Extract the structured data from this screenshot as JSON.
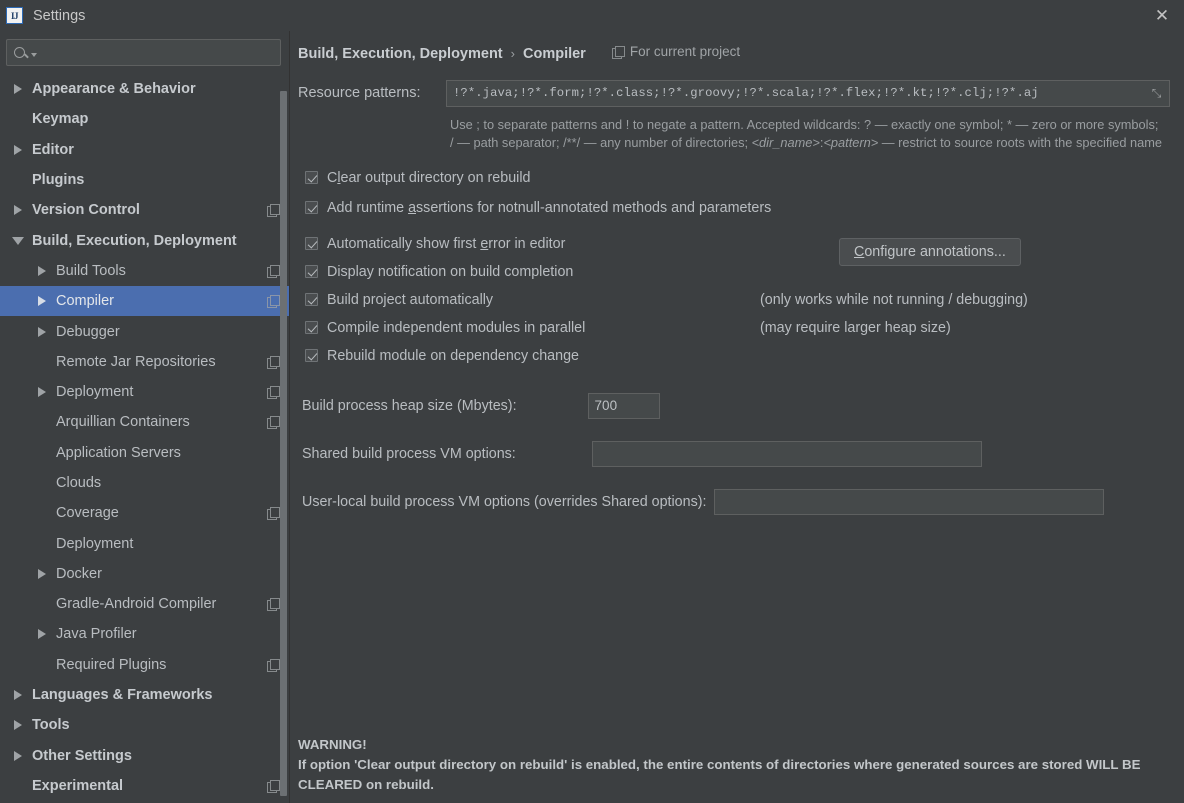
{
  "window": {
    "title": "Settings",
    "logo_text": "IJ",
    "close_label": "✕"
  },
  "sidebar": {
    "search_placeholder": "",
    "search_value": "",
    "items": [
      {
        "label": "Appearance & Behavior",
        "indent": 0,
        "arrow": "right",
        "bold": true,
        "copy": false,
        "selected": false
      },
      {
        "label": "Keymap",
        "indent": 0,
        "arrow": "none",
        "bold": true,
        "copy": false,
        "selected": false
      },
      {
        "label": "Editor",
        "indent": 0,
        "arrow": "right",
        "bold": true,
        "copy": false,
        "selected": false
      },
      {
        "label": "Plugins",
        "indent": 0,
        "arrow": "none",
        "bold": true,
        "copy": false,
        "selected": false
      },
      {
        "label": "Version Control",
        "indent": 0,
        "arrow": "right",
        "bold": true,
        "copy": true,
        "selected": false
      },
      {
        "label": "Build, Execution, Deployment",
        "indent": 0,
        "arrow": "down",
        "bold": true,
        "copy": false,
        "selected": false
      },
      {
        "label": "Build Tools",
        "indent": 1,
        "arrow": "right",
        "bold": false,
        "copy": true,
        "selected": false
      },
      {
        "label": "Compiler",
        "indent": 1,
        "arrow": "right",
        "bold": false,
        "copy": true,
        "selected": true
      },
      {
        "label": "Debugger",
        "indent": 1,
        "arrow": "right",
        "bold": false,
        "copy": false,
        "selected": false
      },
      {
        "label": "Remote Jar Repositories",
        "indent": 1,
        "arrow": "none",
        "bold": false,
        "copy": true,
        "selected": false
      },
      {
        "label": "Deployment",
        "indent": 1,
        "arrow": "right",
        "bold": false,
        "copy": true,
        "selected": false
      },
      {
        "label": "Arquillian Containers",
        "indent": 1,
        "arrow": "none",
        "bold": false,
        "copy": true,
        "selected": false
      },
      {
        "label": "Application Servers",
        "indent": 1,
        "arrow": "none",
        "bold": false,
        "copy": false,
        "selected": false
      },
      {
        "label": "Clouds",
        "indent": 1,
        "arrow": "none",
        "bold": false,
        "copy": false,
        "selected": false
      },
      {
        "label": "Coverage",
        "indent": 1,
        "arrow": "none",
        "bold": false,
        "copy": true,
        "selected": false
      },
      {
        "label": "Deployment",
        "indent": 1,
        "arrow": "none",
        "bold": false,
        "copy": false,
        "selected": false
      },
      {
        "label": "Docker",
        "indent": 1,
        "arrow": "right",
        "bold": false,
        "copy": false,
        "selected": false
      },
      {
        "label": "Gradle-Android Compiler",
        "indent": 1,
        "arrow": "none",
        "bold": false,
        "copy": true,
        "selected": false
      },
      {
        "label": "Java Profiler",
        "indent": 1,
        "arrow": "right",
        "bold": false,
        "copy": false,
        "selected": false
      },
      {
        "label": "Required Plugins",
        "indent": 1,
        "arrow": "none",
        "bold": false,
        "copy": true,
        "selected": false
      },
      {
        "label": "Languages & Frameworks",
        "indent": 0,
        "arrow": "right",
        "bold": true,
        "copy": false,
        "selected": false
      },
      {
        "label": "Tools",
        "indent": 0,
        "arrow": "right",
        "bold": true,
        "copy": false,
        "selected": false
      },
      {
        "label": "Other Settings",
        "indent": 0,
        "arrow": "right",
        "bold": true,
        "copy": false,
        "selected": false
      },
      {
        "label": "Experimental",
        "indent": 0,
        "arrow": "none",
        "bold": true,
        "copy": true,
        "selected": false
      }
    ]
  },
  "content": {
    "breadcrumb": {
      "parent": "Build, Execution, Deployment",
      "separator": "›",
      "current": "Compiler"
    },
    "scope_label": "For current project",
    "resource_patterns": {
      "label": "Resource patterns:",
      "value": "!?*.java;!?*.form;!?*.class;!?*.groovy;!?*.scala;!?*.flex;!?*.kt;!?*.clj;!?*.aj",
      "expand_icon": "⤡"
    },
    "help_text_part1": "Use ; to separate patterns and ! to negate a pattern. Accepted wildcards: ? — exactly one symbol; * — zero or more symbols; / — path separator; /**/ — any number of directories; ",
    "help_text_italic1": "<dir_name>",
    "help_text_mid": ":",
    "help_text_italic2": "<pattern>",
    "help_text_part2": " — restrict to source roots with the specified name",
    "checkboxes": [
      {
        "label_pre": "C",
        "label_mn": "l",
        "label_post": "ear output directory on rebuild",
        "checked": true
      },
      {
        "label_pre": "Add runtime ",
        "label_mn": "a",
        "label_post": "ssertions for notnull-annotated methods and parameters",
        "checked": true
      },
      {
        "label_pre": "Automatically show first ",
        "label_mn": "e",
        "label_post": "rror in editor",
        "checked": true
      },
      {
        "label_pre": "Display notification on build completion",
        "label_mn": "",
        "label_post": "",
        "checked": true
      },
      {
        "label_pre": "Build project automatically",
        "label_mn": "",
        "label_post": "",
        "checked": true
      },
      {
        "label_pre": "Compile independent modules in parallel",
        "label_mn": "",
        "label_post": "",
        "checked": true
      },
      {
        "label_pre": "Rebuild module on dependency change",
        "label_mn": "",
        "label_post": "",
        "checked": true
      }
    ],
    "hint_build_auto": "(only works while not running / debugging)",
    "hint_parallel": "(may require larger heap size)",
    "configure_annotations": {
      "pre": "C",
      "mn": "o",
      "post": "nfigure annotations..."
    },
    "fields": {
      "heap_label": "Build process heap size (Mbytes):",
      "heap_value": "700",
      "shared_label": "Shared build process VM options:",
      "shared_value": "",
      "userlocal_label": "User-local build process VM options (overrides Shared options):",
      "userlocal_value": ""
    },
    "warning_title": "WARNING!",
    "warning_body": "If option 'Clear output directory on rebuild' is enabled, the entire contents of directories where generated sources are stored WILL BE CLEARED on rebuild."
  },
  "colors": {
    "background": "#3c3f41",
    "selection": "#4b6eaf",
    "text": "#b9bdc1",
    "field_bg": "#45494a"
  }
}
